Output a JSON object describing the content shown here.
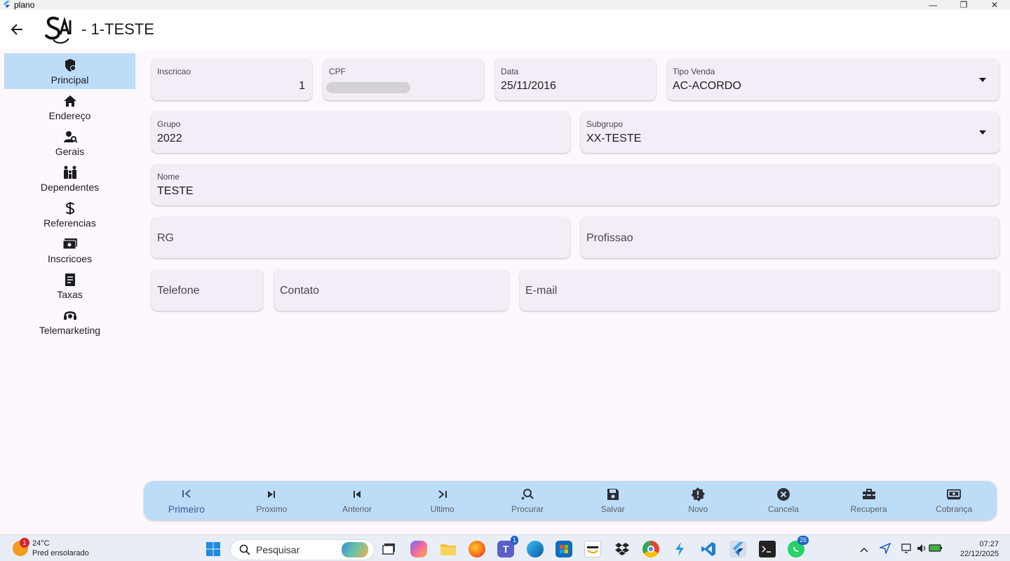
{
  "window": {
    "title": "plano",
    "minimize": "—",
    "maximize": "❐",
    "close": "✕"
  },
  "appbar": {
    "title": "-  1-TESTE"
  },
  "sidebar": {
    "items": [
      {
        "label": "Principal",
        "icon": "shield-icon",
        "active": true
      },
      {
        "label": "Endereço",
        "icon": "home-icon"
      },
      {
        "label": "Gerais",
        "icon": "person-search-icon"
      },
      {
        "label": "Dependentes",
        "icon": "family-icon"
      },
      {
        "label": "Referencias",
        "icon": "dollar-icon"
      },
      {
        "label": "Inscricoes",
        "icon": "card-icon"
      },
      {
        "label": "Taxas",
        "icon": "receipt-icon"
      },
      {
        "label": "Telemarketing",
        "icon": "headset-icon"
      }
    ]
  },
  "form": {
    "inscricao": {
      "label": "Inscricao",
      "value": "1"
    },
    "cpf": {
      "label": "CPF",
      "value": ""
    },
    "data": {
      "label": "Data",
      "value": "25/11/2016"
    },
    "tipo_venda": {
      "label": "Tipo Venda",
      "value": "AC-ACORDO"
    },
    "grupo": {
      "label": "Grupo",
      "value": "2022"
    },
    "subgrupo": {
      "label": "Subgrupo",
      "value": "XX-TESTE"
    },
    "nome": {
      "label": "Nome",
      "value": "TESTE"
    },
    "rg": {
      "placeholder": "RG"
    },
    "profissao": {
      "placeholder": "Profissao"
    },
    "telefone": {
      "placeholder": "Telefone"
    },
    "contato": {
      "placeholder": "Contato"
    },
    "email": {
      "placeholder": "E-mail"
    }
  },
  "toolbar": {
    "items": [
      {
        "label": "Primeiro",
        "icon": "first-page-icon",
        "active": true
      },
      {
        "label": "Proximo",
        "icon": "skip-next-icon"
      },
      {
        "label": "Anterior",
        "icon": "skip-previous-icon"
      },
      {
        "label": "Ultimo",
        "icon": "last-page-icon"
      },
      {
        "label": "Procurar",
        "icon": "search-icon"
      },
      {
        "label": "Salvar",
        "icon": "save-icon"
      },
      {
        "label": "Novo",
        "icon": "new-icon"
      },
      {
        "label": "Cancela",
        "icon": "cancel-icon"
      },
      {
        "label": "Recupera",
        "icon": "toolbox-icon"
      },
      {
        "label": "Cobrança",
        "icon": "payment-icon"
      }
    ]
  },
  "taskbar": {
    "weather": {
      "temp": "24°C",
      "desc": "Pred ensolarado",
      "badge": "1"
    },
    "search_placeholder": "Pesquisar",
    "teams_badge": "1",
    "whatsapp_badge": "26",
    "time": "07:27",
    "date": "22/12/2025"
  },
  "colors": {
    "accent": "#bcdcf7",
    "field_bg": "#f3edf7",
    "page_bg": "#fdf7fe",
    "active_label": "#3d5b93"
  }
}
